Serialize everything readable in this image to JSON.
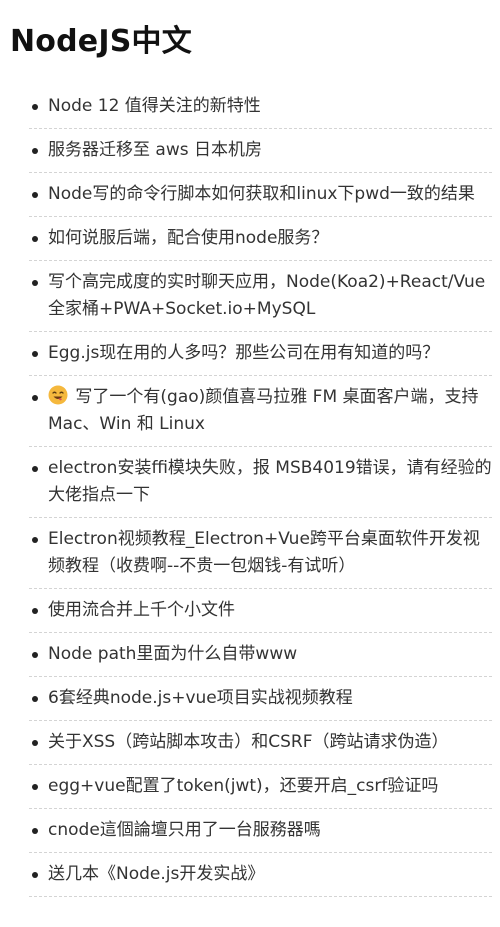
{
  "page": {
    "title": "NodeJS中文"
  },
  "topics": [
    {
      "label": "Node 12 值得关注的新特性"
    },
    {
      "label": "服务器迁移至 aws 日本机房"
    },
    {
      "label": "Node写的命令行脚本如何获取和linux下pwd一致的结果"
    },
    {
      "label": "如何说服后端，配合使用node服务？"
    },
    {
      "label": "写个高完成度的实时聊天应用，Node(Koa2)+React/Vue全家桶+PWA+Socket.io+MySQL"
    },
    {
      "label": "Egg.js现在用的人多吗？那些公司在用有知道的吗？"
    },
    {
      "label": "写了一个有(gao)颜值喜马拉雅 FM 桌面客户端，支持 Mac、Win 和 Linux",
      "icon": "smiling-face-emoji-icon"
    },
    {
      "label": "electron安装ffi模块失败，报 MSB4019错误，请有经验的大佬指点一下"
    },
    {
      "label": "Electron视频教程_Electron+Vue跨平台桌面软件开发视频教程（收费啊--不贵一包烟钱-有试听）"
    },
    {
      "label": "使用流合并上千个小文件"
    },
    {
      "label": "Node path里面为什么自带www"
    },
    {
      "label": "6套经典node.js+vue项目实战视频教程"
    },
    {
      "label": "关于XSS（跨站脚本攻击）和CSRF（跨站请求伪造）"
    },
    {
      "label": "egg+vue配置了token(jwt)，还要开启_csrf验证吗"
    },
    {
      "label": "cnode這個論壇只用了一台服務器嗎"
    },
    {
      "label": "送几本《Node.js开发实战》"
    }
  ],
  "colors": {
    "text": "#333333",
    "title": "#111111",
    "divider": "#d4d4d4"
  }
}
